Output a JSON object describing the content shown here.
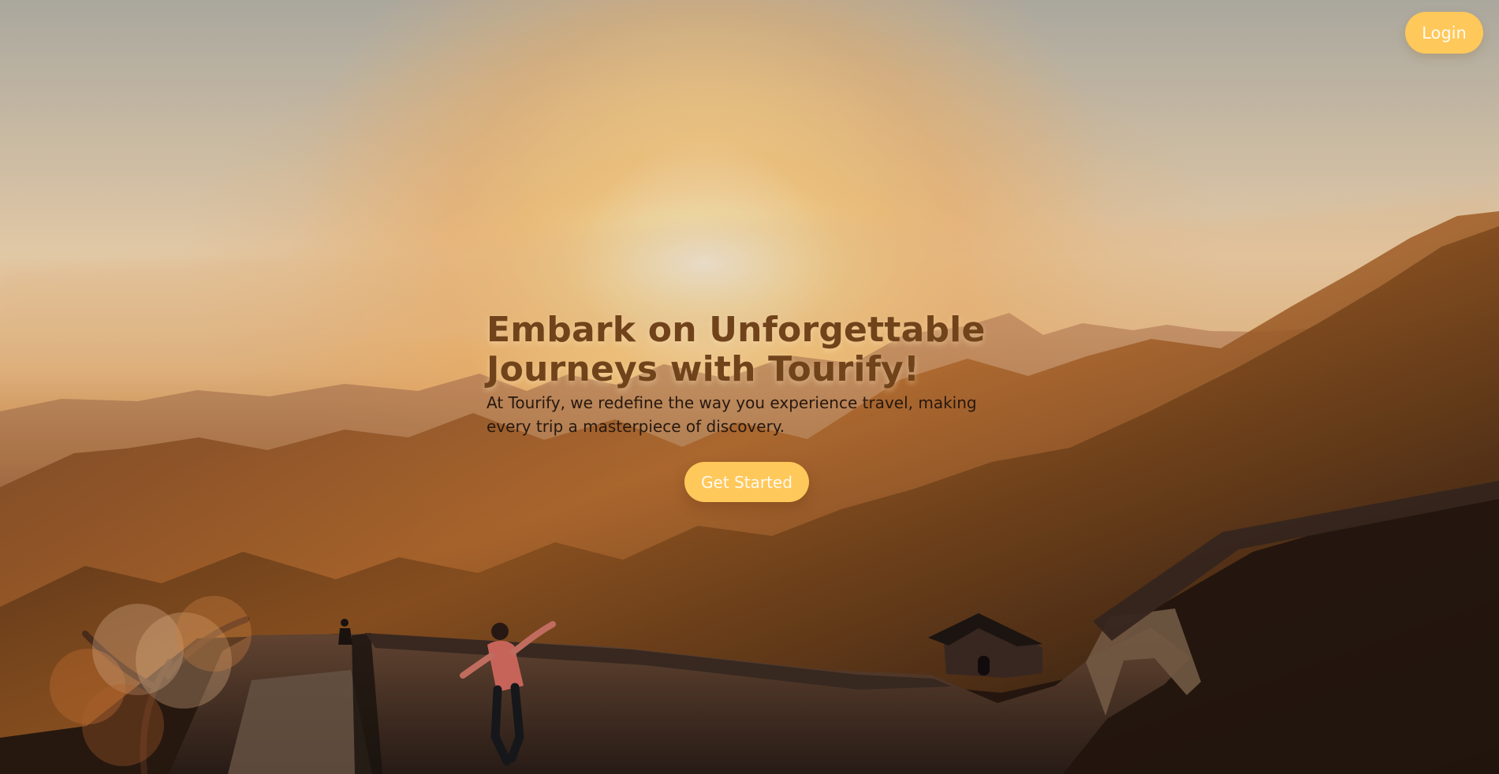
{
  "header": {
    "login_label": "Login"
  },
  "hero": {
    "headline_line_1": "Embark on Unforgettable",
    "headline_line_2": "Journeys with Tourify!",
    "description_line_1": "At Tourify, we redefine the way you experience travel, making",
    "description_line_2": "every trip a masterpiece of discovery.",
    "cta_label": "Get Started"
  },
  "colors": {
    "accent": "#ffc85a",
    "headline": "#70431b",
    "body_text": "#27180e"
  }
}
